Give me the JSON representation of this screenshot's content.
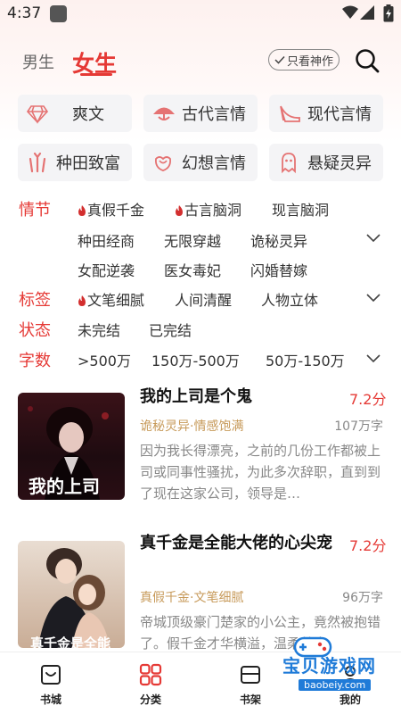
{
  "status_bar": {
    "time": "4:37"
  },
  "header": {
    "tab_male": "男生",
    "tab_female": "女生",
    "only_god": "只看神作"
  },
  "categories": [
    {
      "label": "爽文",
      "icon": "diamond-icon"
    },
    {
      "label": "古代言情",
      "icon": "umbrella-icon"
    },
    {
      "label": "现代言情",
      "icon": "high-heel-icon"
    },
    {
      "label": "种田致富",
      "icon": "wheat-icon"
    },
    {
      "label": "幻想言情",
      "icon": "rose-icon"
    },
    {
      "label": "悬疑灵异",
      "icon": "ghost-icon"
    }
  ],
  "filters": {
    "plot": {
      "key": "情节",
      "options": [
        "真假千金",
        "古言脑洞",
        "现言脑洞",
        "种田经商",
        "无限穿越",
        "诡秘灵异",
        "女配逆袭",
        "医女毒妃",
        "闪婚替嫁"
      ]
    },
    "tags": {
      "key": "标签",
      "options": [
        "文笔细腻",
        "人间清醒",
        "人物立体"
      ]
    },
    "status": {
      "key": "状态",
      "options": [
        "未完结",
        "已完结"
      ]
    },
    "words": {
      "key": "字数",
      "options": [
        ">500万",
        "150万-500万",
        "50万-150万"
      ]
    }
  },
  "books": [
    {
      "title": "我的上司是个鬼",
      "score": "7.2分",
      "tags": "诡秘灵异·情感饱满",
      "words": "107万字",
      "desc": "因为我长得漂亮，之前的几份工作都被上司或同事性骚扰，为此多次辞职，直到到了现在这家公司，领导是…",
      "cover_text": "我的上司"
    },
    {
      "title": "真千金是全能大佬的心尖宠",
      "score": "7.2分",
      "tags": "真假千金·文笔细腻",
      "words": "96万字",
      "desc": "帝城顶级豪门楚家的小公主，竟然被抱错了。假千金才华横溢，温柔善良",
      "cover_text": "真千金是全能"
    }
  ],
  "bottom_nav": [
    {
      "label": "书城"
    },
    {
      "label": "分类"
    },
    {
      "label": "书架"
    },
    {
      "label": "我的"
    }
  ],
  "watermark": {
    "title": "宝贝游戏网",
    "url": "baobeiy.com"
  },
  "colors": {
    "accent": "#e53935",
    "tag": "#c79a5a"
  }
}
